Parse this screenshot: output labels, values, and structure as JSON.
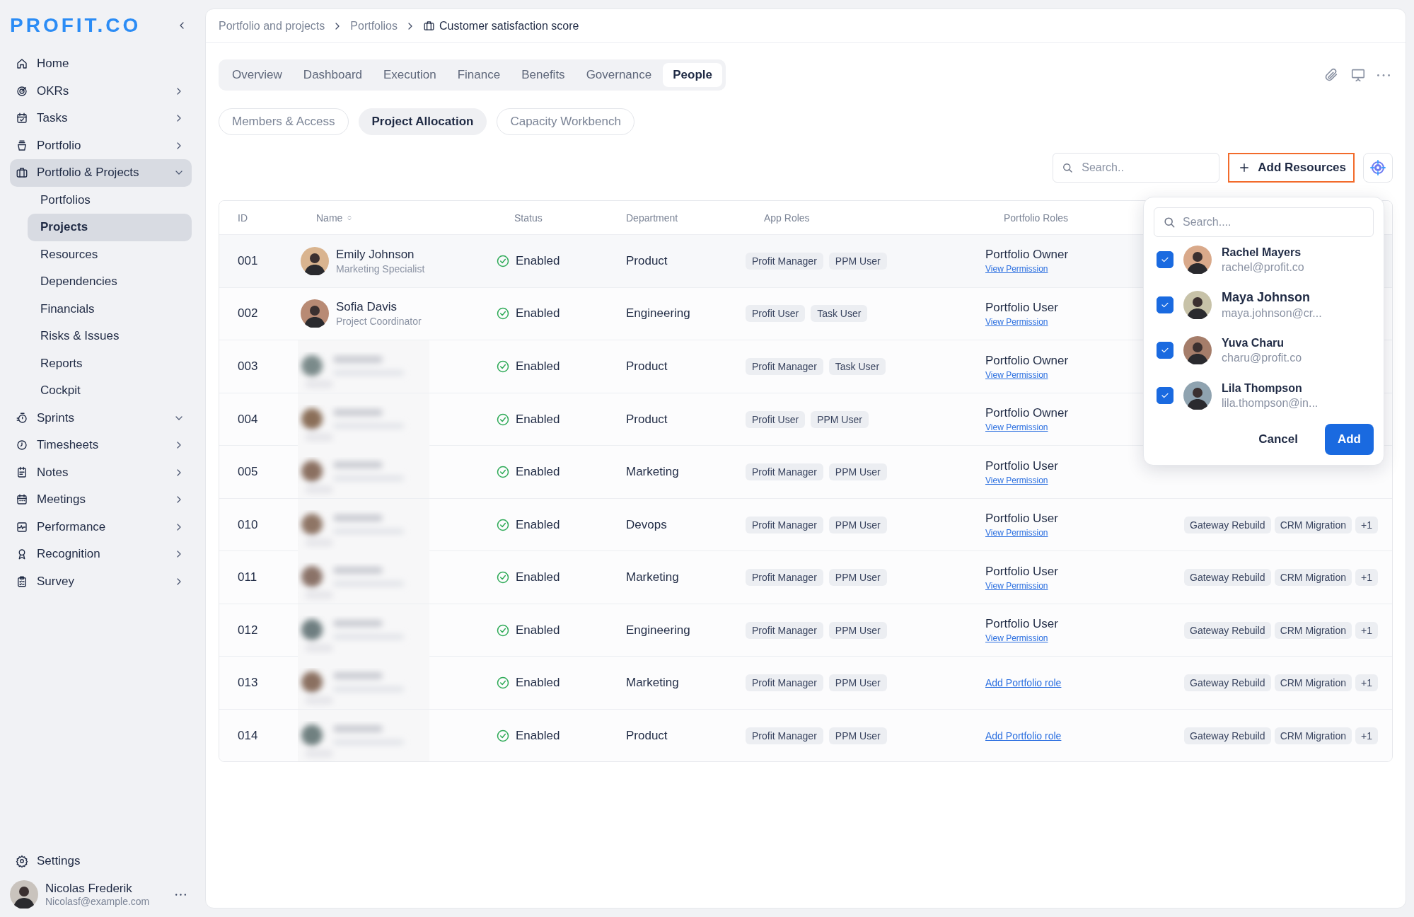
{
  "logo": "PROFIT.CO",
  "sidebar": {
    "items": [
      {
        "label": "Home",
        "selected": false
      },
      {
        "label": "OKRs",
        "selected": false,
        "expanded": false
      },
      {
        "label": "Tasks",
        "selected": false,
        "expanded": false
      },
      {
        "label": "Portfolio",
        "selected": false,
        "expanded": false
      },
      {
        "label": "Portfolio & Projects",
        "selected": true,
        "expanded": true,
        "children": [
          {
            "label": "Portfolios",
            "selected": false
          },
          {
            "label": "Projects",
            "selected": true
          },
          {
            "label": "Resources",
            "selected": false
          },
          {
            "label": "Dependencies",
            "selected": false
          },
          {
            "label": "Financials",
            "selected": false
          },
          {
            "label": "Risks & Issues",
            "selected": false
          },
          {
            "label": "Reports",
            "selected": false
          },
          {
            "label": "Cockpit",
            "selected": false
          }
        ]
      },
      {
        "label": "Sprints",
        "selected": false,
        "expanded": true
      },
      {
        "label": "Timesheets",
        "selected": false,
        "expanded": false
      },
      {
        "label": "Notes",
        "selected": false,
        "expanded": false
      },
      {
        "label": "Meetings",
        "selected": false,
        "expanded": false
      },
      {
        "label": "Performance",
        "selected": false,
        "expanded": false
      },
      {
        "label": "Recognition",
        "selected": false,
        "expanded": false
      },
      {
        "label": "Survey",
        "selected": false,
        "expanded": false
      }
    ],
    "settings": "Settings",
    "user": {
      "name": "Nicolas Frederik",
      "email": "Nicolasf@example.com"
    }
  },
  "breadcrumb": [
    "Portfolio and projects",
    "Portfolios",
    "Customer satisfaction score"
  ],
  "tabs": [
    {
      "label": "Overview",
      "selected": false
    },
    {
      "label": "Dashboard",
      "selected": false
    },
    {
      "label": "Execution",
      "selected": false
    },
    {
      "label": "Finance",
      "selected": false
    },
    {
      "label": "Benefits",
      "selected": false
    },
    {
      "label": "Governance",
      "selected": false
    },
    {
      "label": "People",
      "selected": true
    }
  ],
  "subtabs": [
    {
      "label": "Members & Access",
      "selected": false
    },
    {
      "label": "Project Allocation",
      "selected": true
    },
    {
      "label": "Capacity Workbench",
      "selected": false
    }
  ],
  "search": {
    "placeholder": "Search.."
  },
  "add_button": "Add Resources",
  "table": {
    "columns": [
      {
        "label": "ID",
        "sortable": false
      },
      {
        "label": "Name",
        "sortable": true
      },
      {
        "label": "Status",
        "sortable": false
      },
      {
        "label": "Department",
        "sortable": false
      },
      {
        "label": "App Roles",
        "sortable": false
      },
      {
        "label": "Portfolio Roles",
        "sortable": false
      }
    ],
    "rows": [
      {
        "id": "001",
        "person": {
          "kind": "person",
          "name": "Emily Johnson",
          "title": "Marketing Specialist"
        },
        "status": "Enabled",
        "department": "Product",
        "app_roles": [
          "Profit Manager",
          "PPM User"
        ],
        "portfolio_role": {
          "kind": "role",
          "role": "Portfolio Owner",
          "link": "View Permission"
        }
      },
      {
        "id": "002",
        "person": {
          "kind": "person",
          "name": "Sofia Davis",
          "title": "Project Coordinator"
        },
        "status": "Enabled",
        "department": "Engineering",
        "app_roles": [
          "Profit User",
          "Task User"
        ],
        "portfolio_role": {
          "kind": "role",
          "role": "Portfolio User",
          "link": "View Permission"
        }
      },
      {
        "id": "003",
        "person": {
          "kind": "picture"
        },
        "status": "Enabled",
        "department": "Product",
        "app_roles": [
          "Profit Manager",
          "Task User"
        ],
        "portfolio_role": {
          "kind": "role",
          "role": "Portfolio Owner",
          "link": "View Permission"
        }
      },
      {
        "id": "004",
        "person": {
          "kind": "picture"
        },
        "status": "Enabled",
        "department": "Product",
        "app_roles": [
          "Profit User",
          "PPM User"
        ],
        "portfolio_role": {
          "kind": "role",
          "role": "Portfolio Owner",
          "link": "View Permission"
        }
      },
      {
        "id": "005",
        "person": {
          "kind": "picture"
        },
        "status": "Enabled",
        "department": "Marketing",
        "app_roles": [
          "Profit Manager",
          "PPM User"
        ],
        "portfolio_role": {
          "kind": "role",
          "role": "Portfolio User",
          "link": "View Permission"
        }
      },
      {
        "id": "010",
        "person": {
          "kind": "picture"
        },
        "status": "Enabled",
        "department": "Devops",
        "app_roles": [
          "Profit Manager",
          "PPM User"
        ],
        "portfolio_role": {
          "kind": "role",
          "role": "Portfolio User",
          "link": "View Permission"
        },
        "projects": [
          "Gateway Rebuild",
          "CRM Migration",
          "+1"
        ]
      },
      {
        "id": "011",
        "person": {
          "kind": "picture"
        },
        "status": "Enabled",
        "department": "Marketing",
        "app_roles": [
          "Profit Manager",
          "PPM User"
        ],
        "portfolio_role": {
          "kind": "role",
          "role": "Portfolio User",
          "link": "View Permission"
        },
        "projects": [
          "Gateway Rebuild",
          "CRM Migration",
          "+1"
        ]
      },
      {
        "id": "012",
        "person": {
          "kind": "picture"
        },
        "status": "Enabled",
        "department": "Engineering",
        "app_roles": [
          "Profit Manager",
          "PPM User"
        ],
        "portfolio_role": {
          "kind": "role",
          "role": "Portfolio User",
          "link": "View Permission"
        },
        "projects": [
          "Gateway Rebuild",
          "CRM Migration",
          "+1"
        ]
      },
      {
        "id": "013",
        "person": {
          "kind": "picture"
        },
        "status": "Enabled",
        "department": "Marketing",
        "app_roles": [
          "Profit Manager",
          "PPM User"
        ],
        "portfolio_role": {
          "kind": "add",
          "link": "Add Portfolio role"
        },
        "projects": [
          "Gateway Rebuild",
          "CRM Migration",
          "+1"
        ]
      },
      {
        "id": "014",
        "person": {
          "kind": "picture"
        },
        "status": "Enabled",
        "department": "Product",
        "app_roles": [
          "Profit Manager",
          "PPM User"
        ],
        "portfolio_role": {
          "kind": "add",
          "link": "Add Portfolio role"
        },
        "projects": [
          "Gateway Rebuild",
          "CRM Migration",
          "+1"
        ]
      }
    ]
  },
  "popup": {
    "search": {
      "placeholder": "Search...."
    },
    "people": [
      {
        "name": "Rachel Mayers",
        "email": "rachel@profit.co",
        "checked": true
      },
      {
        "name": "Maya Johnson",
        "email": "maya.johnson@cr...",
        "checked": true
      },
      {
        "name": "Yuva Charu",
        "email": "charu@profit.co",
        "checked": true
      },
      {
        "name": "Lila Thompson",
        "email": "lila.thompson@in...",
        "checked": true
      }
    ],
    "buttons": [
      {
        "label": "Cancel",
        "kind": "secondary"
      },
      {
        "label": "Add",
        "kind": "primary"
      }
    ]
  }
}
